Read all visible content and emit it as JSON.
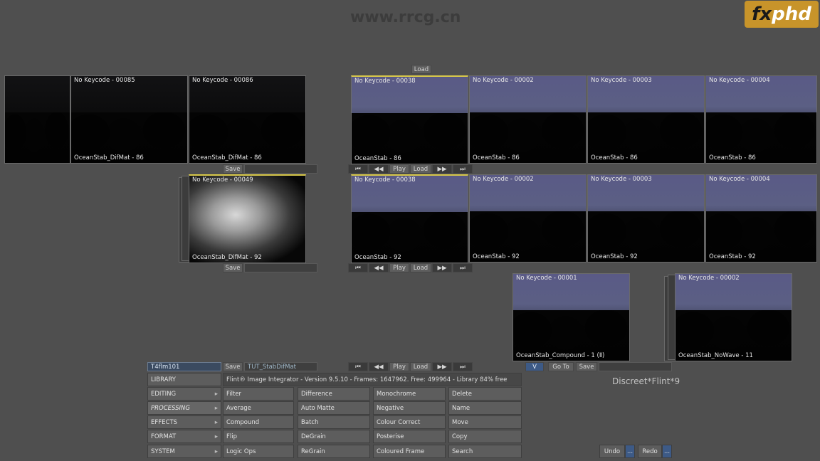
{
  "watermark": {
    "site": "www.rrcg.cn",
    "logo_a": "fx",
    "logo_b": "phd"
  },
  "top_load_label": "Load",
  "left_reels": {
    "row1": [
      {
        "top": "",
        "bottom": ""
      },
      {
        "top": "No Keycode - 00085",
        "bottom": "OceanStab_DifMat - 86"
      },
      {
        "top": "No Keycode - 00086",
        "bottom": "OceanStab_DifMat - 86"
      }
    ],
    "row2": {
      "top": "No Keycode - 00049",
      "bottom": "OceanStab_DifMat - 92"
    },
    "save_label": "Save"
  },
  "right_reels": {
    "row1": [
      {
        "top": "No Keycode - 00038",
        "bottom": "OceanStab - 86"
      },
      {
        "top": "No Keycode - 00002",
        "bottom": "OceanStab - 86"
      },
      {
        "top": "No Keycode - 00003",
        "bottom": "OceanStab - 86"
      },
      {
        "top": "No Keycode - 00004",
        "bottom": "OceanStab - 86"
      }
    ],
    "row2": [
      {
        "top": "No Keycode - 00038",
        "bottom": "OceanStab - 92"
      },
      {
        "top": "No Keycode - 00002",
        "bottom": "OceanStab - 92"
      },
      {
        "top": "No Keycode - 00003",
        "bottom": "OceanStab - 92"
      },
      {
        "top": "No Keycode - 00004",
        "bottom": "OceanStab - 92"
      }
    ],
    "transport": {
      "start": "⏮",
      "rew": "◀◀",
      "play": "Play",
      "load": "Load",
      "ff": "▶▶",
      "end": "⏭"
    }
  },
  "clips": [
    {
      "top": "No Keycode - 00001",
      "bottom": "OceanStab_Compound - 1 (Ⅱ)"
    },
    {
      "top": "No Keycode - 00002",
      "bottom": "OceanStab_NoWave - 11"
    }
  ],
  "clip_controls": {
    "v": "V",
    "goto": "Go To",
    "save": "Save"
  },
  "bottom_bar": {
    "project": "T4flm101",
    "save": "Save",
    "clip_name": "TUT_StabDifMat",
    "transport": {
      "start": "⏮",
      "rew": "◀◀",
      "play": "Play",
      "load": "Load",
      "ff": "▶▶",
      "end": "⏭"
    }
  },
  "status_text": "Flint® Image Integrator - Version 9.5.10 - Frames: 1647962. Free: 499964 - Library 84% free",
  "brand": "Discreet*Flint*9",
  "menu": [
    "LIBRARY",
    "EDITING",
    "PROCESSING",
    "EFFECTS",
    "FORMAT",
    "SYSTEM"
  ],
  "grid": [
    [
      "Filter",
      "Difference",
      "Monochrome",
      "Delete"
    ],
    [
      "Average",
      "Auto Matte",
      "Negative",
      "Name"
    ],
    [
      "Compound",
      "Batch",
      "Colour Correct",
      "Move"
    ],
    [
      "Flip",
      "DeGrain",
      "Posterise",
      "Copy"
    ],
    [
      "Logic Ops",
      "ReGrain",
      "Coloured Frame",
      "Search"
    ]
  ],
  "undo": "Undo",
  "redo": "Redo",
  "ellipsis": "..."
}
